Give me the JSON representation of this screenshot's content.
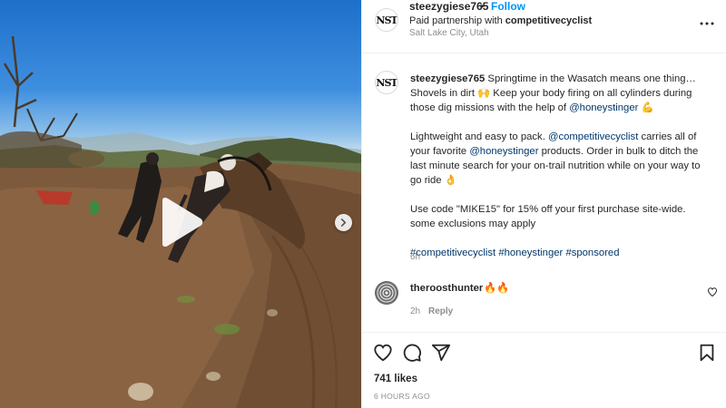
{
  "post": {
    "author": "steezygiese765",
    "follow_label": "Follow",
    "separator": "•",
    "partnership_prefix": "Paid partnership with",
    "partner": "competitivecyclist",
    "location": "Salt Lake City, Utah",
    "avatar_text": "NST"
  },
  "caption": {
    "username": "steezygiese765",
    "p1_a": "Springtime in the Wasatch means one thing…",
    "p1_b": "Shovels in dirt 🙌 Keep your body firing on all cylinders during those dig missions with the help of",
    "p1_mention": "@honeystinger",
    "p1_end": "💪",
    "p2_a": "Lightweight and easy to pack.",
    "p2_mention1": "@competitivecyclist",
    "p2_b": "carries all of your favorite",
    "p2_mention2": "@honeystinger",
    "p2_c": "products. Order in bulk to ditch the last minute search for your on-trail nutrition while on your way to go ride 👌",
    "p3": "Use code \"MIKE15\" for 15% off your first purchase site-wide. some exclusions may apply",
    "tags": [
      "#competitivecyclist",
      "#honeystinger",
      "#sponsored"
    ],
    "time": "6h"
  },
  "comment": {
    "username": "theroosthunter",
    "text": "🔥🔥",
    "time": "2h",
    "reply_label": "Reply"
  },
  "footer": {
    "likes": "741 likes",
    "posted": "6 HOURS AGO"
  },
  "icons": {
    "more": "more-options-icon",
    "play": "play-icon",
    "next": "chevron-right-icon",
    "like": "heart-icon",
    "comment": "comment-icon",
    "share": "share-icon",
    "save": "bookmark-icon"
  },
  "colors": {
    "link": "#00376b",
    "follow": "#0095f6",
    "muted": "#8e8e8e",
    "text": "#262626"
  }
}
